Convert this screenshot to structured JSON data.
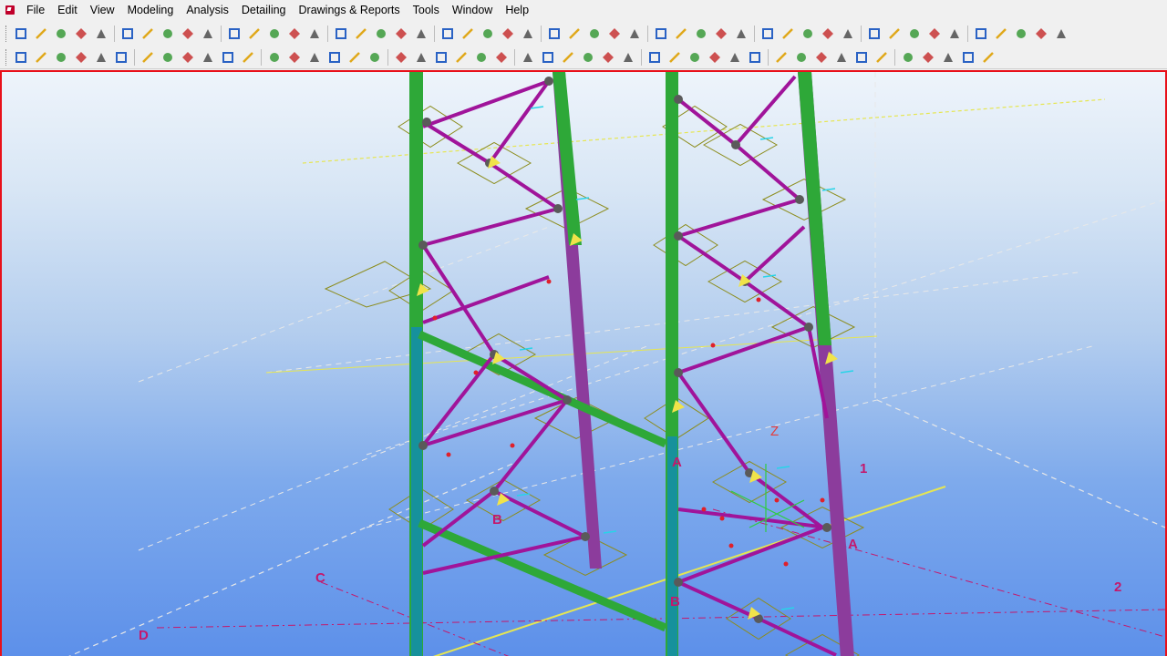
{
  "menu": {
    "items": [
      "File",
      "Edit",
      "View",
      "Modeling",
      "Analysis",
      "Detailing",
      "Drawings & Reports",
      "Tools",
      "Window",
      "Help"
    ]
  },
  "toolbar1": {
    "icons": [
      "new-icon",
      "open-icon",
      "save-icon",
      "undo-icon",
      "redo-icon",
      "copy-icon",
      "move-icon",
      "copy-special-icon",
      "mirror-icon",
      "select-all-icon",
      "window-icon",
      "frame-icon",
      "cut-icon",
      "explode-icon",
      "view-new-icon",
      "view-open-icon",
      "view-front-icon",
      "view-3d-icon",
      "smart-select-icon",
      "pick-icon",
      "component-icon",
      "component-2-icon",
      "help-icon",
      "grid-icon",
      "point-icon",
      "cross-icon",
      "pen-icon",
      "measure-icon",
      "key-icon",
      "clash-icon",
      "class-icon",
      "number-icon",
      "report-icon",
      "drawing-icon",
      "doc-manager-icon",
      "arrow-right-icon",
      "pin-icon",
      "inquire-icon",
      "lock-icon",
      "unlock-icon",
      "column-icon",
      "beam-icon",
      "slab-icon",
      "panel-icon",
      "plate-icon",
      "loft-icon",
      "bolt-icon",
      "weld-icon",
      "snap-icon",
      "more-icon"
    ],
    "colors": {
      "blue": "#2a62c4",
      "yellow": "#e0a81a",
      "green": "#3a9a3a",
      "red": "#c42828",
      "gray": "#666666"
    }
  },
  "toolbar2": {
    "icons": [
      "help-select-icon",
      "help-context-icon",
      "query-icon",
      "sort-icon",
      "filter-icon",
      "select-part-icon",
      "select-assembly-icon",
      "column-icon",
      "beam-icon",
      "polybeam-icon",
      "curved-beam-icon",
      "slab-icon",
      "view-icon",
      "component-icon",
      "binoculars-icon",
      "properties-icon",
      "points-icon",
      "cube-icon",
      "cut-line-icon",
      "fit-icon",
      "move-down-icon",
      "group-icon",
      "components-icon",
      "grid-snap-icon",
      "line-icon",
      "point-line-icon",
      "perp-icon",
      "mid-icon",
      "end-icon",
      "nearest-icon",
      "snap-point-icon",
      "circle-snap-icon",
      "zoom-in-icon",
      "zoom-out-icon",
      "zoom-original-icon",
      "box-icon",
      "rect-icon",
      "circle-icon",
      "triangle-icon",
      "cross-icon",
      "angle-icon",
      "check-icon",
      "sum-icon",
      "arrow-icon",
      "view-window-icon",
      "view-tile-icon",
      "view-full-icon"
    ]
  },
  "viewport": {
    "grid_labels": {
      "A1": "A",
      "A2": "A",
      "B1": "B",
      "B2": "B",
      "C": "C",
      "D": "D",
      "one": "1",
      "two": "2",
      "z": "Z"
    },
    "colors": {
      "column_green": "#2ea838",
      "column_teal": "#16919c",
      "column_purple": "#8c3c9c",
      "brace_magenta": "#a0149a",
      "node_gray": "#5a5a5a",
      "connection_olive": "#8c8c1c",
      "grid_line": "#e8e8e8",
      "grid_yellow": "#e6e651",
      "marker_red": "#e0202a",
      "label_pink": "#c4186c"
    }
  }
}
